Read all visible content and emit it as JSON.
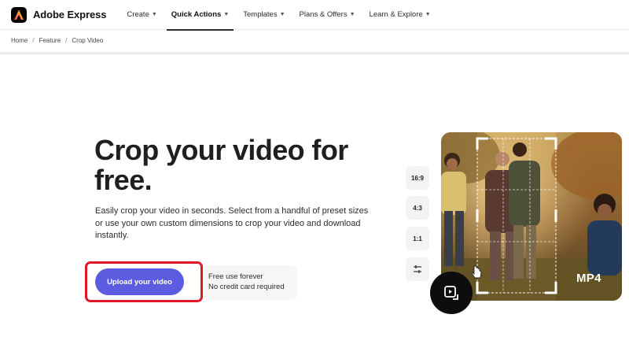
{
  "brand": {
    "name": "Adobe Express"
  },
  "nav": {
    "items": [
      {
        "label": "Create",
        "has_menu": true,
        "active": false
      },
      {
        "label": "Quick Actions",
        "has_menu": true,
        "active": true
      },
      {
        "label": "Templates",
        "has_menu": true,
        "active": false
      },
      {
        "label": "Plans & Offers",
        "has_menu": true,
        "active": false
      },
      {
        "label": "Learn & Explore",
        "has_menu": true,
        "active": false
      }
    ]
  },
  "breadcrumb": {
    "items": [
      "Home",
      "Feature",
      "Crop Video"
    ],
    "separator": "/"
  },
  "hero": {
    "title": "Crop your video for free.",
    "description": "Easily crop your video in seconds. Select from a handful of preset sizes or use your own custom dimensions to crop your video and download instantly."
  },
  "cta": {
    "label": "Upload your video",
    "info_line_1": "Free use forever",
    "info_line_2": "No credit card required"
  },
  "aspect_ratios": [
    "16:9",
    "4:3",
    "1:1"
  ],
  "visual": {
    "format_badge": "MP4"
  },
  "colors": {
    "accent": "#5c5ce0",
    "highlight": "#e0192a",
    "text": "#2c2c2c"
  },
  "icons": {
    "chevron": "chevron-down-icon",
    "custom_size": "sliders-icon",
    "video": "video-crop-icon",
    "cursor": "hand-cursor-icon"
  }
}
